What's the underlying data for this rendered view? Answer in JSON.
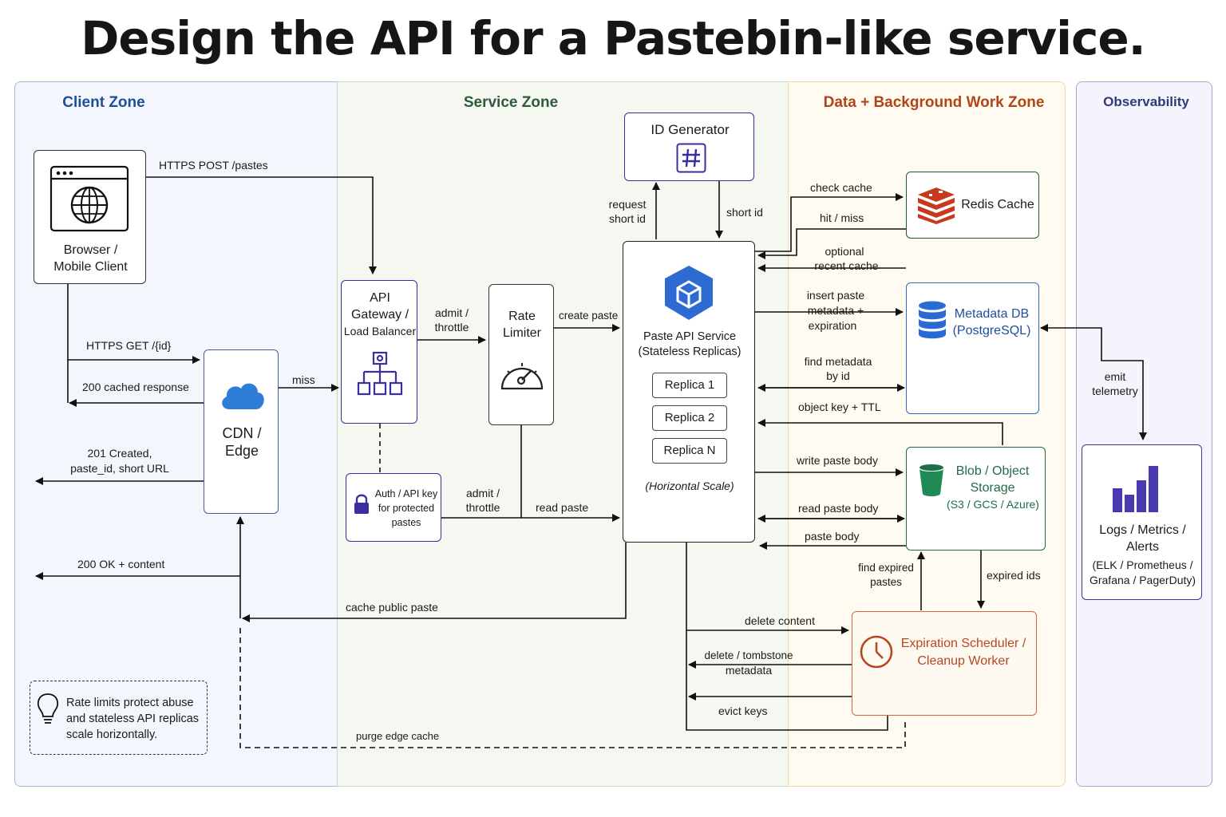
{
  "title": "Design the API for a Pastebin-like service.",
  "zones": {
    "client": "Client Zone",
    "service": "Service Zone",
    "data": "Data + Background Work Zone",
    "observability": "Observability"
  },
  "nodes": {
    "browser": {
      "line1": "Browser /",
      "line2": "Mobile Client",
      "icon": "globe-browser-icon"
    },
    "cdn": {
      "line1": "CDN /",
      "line2": "Edge",
      "icon": "cloud-icon"
    },
    "gateway": {
      "line1": "API",
      "line2": "Gateway /",
      "line3": "Load Balancer",
      "icon": "hierarchy-icon"
    },
    "auth": {
      "line1": "Auth / API key",
      "line2": "for protected",
      "line3": "pastes",
      "icon": "lock-icon"
    },
    "rate_limiter": {
      "line1": "Rate",
      "line2": "Limiter",
      "icon": "gauge-icon"
    },
    "id_generator": {
      "label": "ID Generator",
      "icon": "hash-icon"
    },
    "paste_api": {
      "line1": "Paste API Service",
      "line2": "(Stateless Replicas)",
      "replicas": [
        "Replica 1",
        "Replica 2",
        "Replica N"
      ],
      "scale_note": "(Horizontal Scale)",
      "icon": "cube-icon"
    },
    "redis": {
      "label": "Redis Cache",
      "icon": "redis-stack-icon"
    },
    "metadata_db": {
      "line1": "Metadata DB",
      "line2": "(PostgreSQL)",
      "icon": "database-icon"
    },
    "blob": {
      "line1": "Blob / Object",
      "line2": "Storage",
      "line3": "(S3 / GCS / Azure)",
      "icon": "bucket-icon"
    },
    "scheduler": {
      "line1": "Expiration Scheduler /",
      "line2": "Cleanup Worker",
      "icon": "clock-icon"
    },
    "observability": {
      "line1": "Logs / Metrics /",
      "line2": "Alerts",
      "line3": "(ELK / Prometheus /",
      "line4": "Grafana / PagerDuty)",
      "icon": "bar-chart-icon"
    }
  },
  "edges": {
    "https_post": "HTTPS POST /pastes",
    "https_get": "HTTPS GET /{id}",
    "cached_200": "200 cached response",
    "created_201_a": "201 Created,",
    "created_201_b": "paste_id, short URL",
    "ok_200": "200 OK + content",
    "miss": "miss",
    "admit_throttle_a": "admit /",
    "admit_throttle_b": "throttle",
    "admit_throttle2_a": "admit /",
    "admit_throttle2_b": "throttle",
    "create_paste": "create paste",
    "read_paste": "read paste",
    "request_short_id_a": "request",
    "request_short_id_b": "short id",
    "short_id": "short id",
    "check_cache": "check cache",
    "hit_miss": "hit / miss",
    "optional_recent_a": "optional",
    "optional_recent_b": "recent cache",
    "insert_meta_a": "insert paste",
    "insert_meta_b": "metadata +",
    "insert_meta_c": "expiration",
    "find_meta_a": "find metadata",
    "find_meta_b": "by id",
    "object_key": "object key + TTL",
    "write_body": "write paste body",
    "read_body": "read paste body",
    "paste_body": "paste body",
    "find_expired_a": "find expired",
    "find_expired_b": "pastes",
    "expired_ids": "expired ids",
    "delete_content": "delete content",
    "delete_tombstone_a": "delete / tombstone",
    "delete_tombstone_b": "metadata",
    "evict_keys": "evict keys",
    "cache_public": "cache public paste",
    "purge_edge": "purge edge cache",
    "emit_telemetry_a": "emit",
    "emit_telemetry_b": "telemetry"
  },
  "note": {
    "line1": "Rate limits protect abuse",
    "line2": "and stateless API replicas",
    "line3": "scale horizontally.",
    "icon": "lightbulb-icon"
  },
  "colors": {
    "client_zone": "#f3f6fc",
    "service_zone": "#f3f7f1",
    "data_zone": "#fffbf1",
    "obs_zone": "#f5f4fc",
    "client_title": "#1f4f9a",
    "service_title": "#2e5a3a",
    "data_title": "#b2441a",
    "obs_title": "#2f3a7a",
    "accent_purple": "#3a2fa0",
    "accent_blue": "#2a6ad4",
    "redis_red": "#c8391f",
    "blob_green": "#1f6e47",
    "scheduler_orange": "#b8461e"
  }
}
